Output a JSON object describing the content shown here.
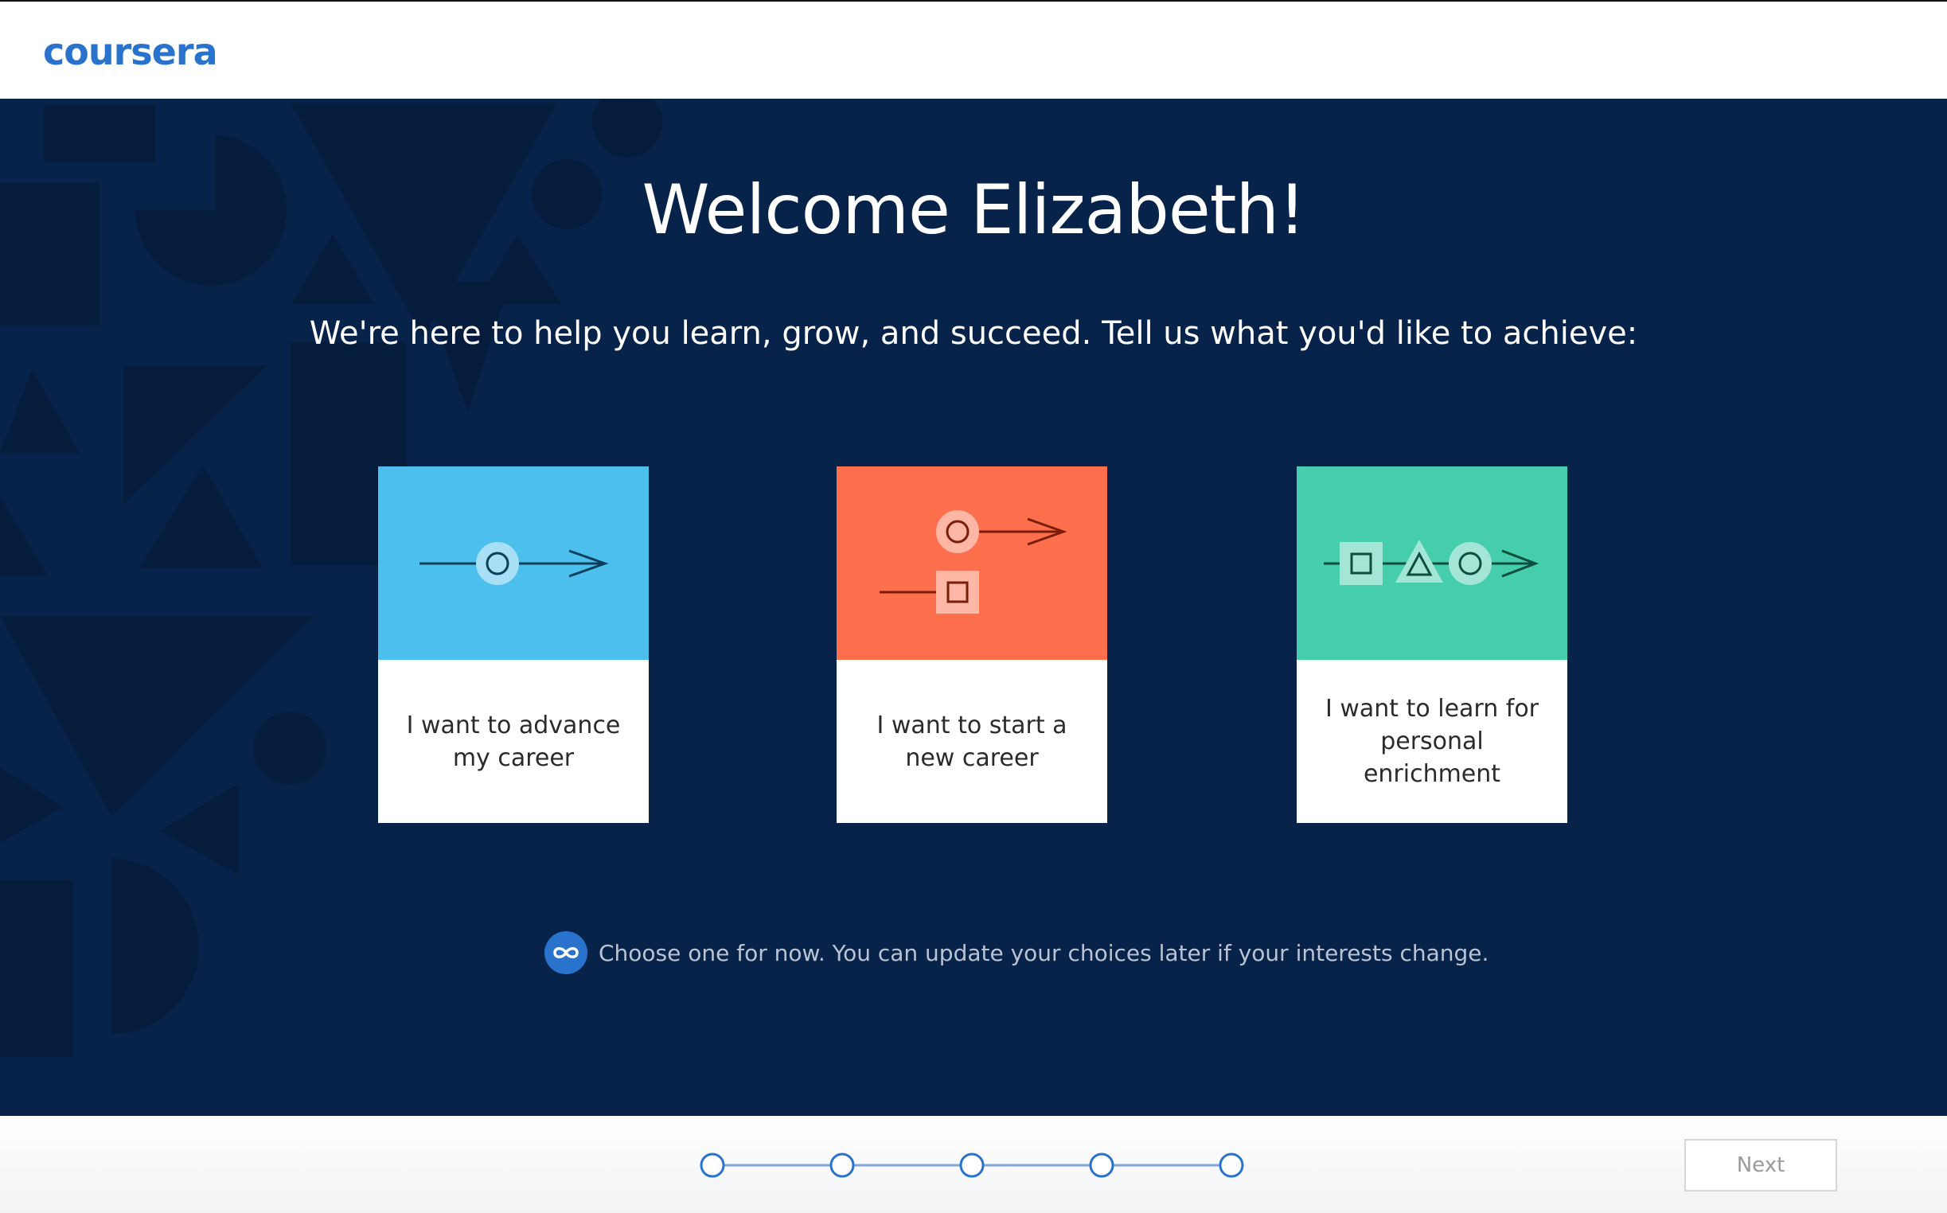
{
  "header": {
    "logo_text": "coursera"
  },
  "main": {
    "title": "Welcome Elizabeth!",
    "subtitle": "We're here to help you learn, grow, and succeed. Tell us what you'd like to achieve:",
    "cards": [
      {
        "label": "I want to advance my career",
        "color": "#4cbfec",
        "icon": "single-path-arrow-icon"
      },
      {
        "label": "I want to start a new career",
        "color": "#fd6f4d",
        "icon": "two-path-arrows-icon"
      },
      {
        "label": "I want to learn for personal enrichment",
        "color": "#46cdab",
        "icon": "shapes-path-arrow-icon"
      }
    ],
    "note": "Choose one for now. You can update your choices later if your interests change.",
    "note_icon": "infinity-icon"
  },
  "footer": {
    "progress": {
      "total_steps": 5
    },
    "next_label": "Next"
  },
  "colors": {
    "hero_bg": "#08234a",
    "brand": "#2a73cc"
  }
}
